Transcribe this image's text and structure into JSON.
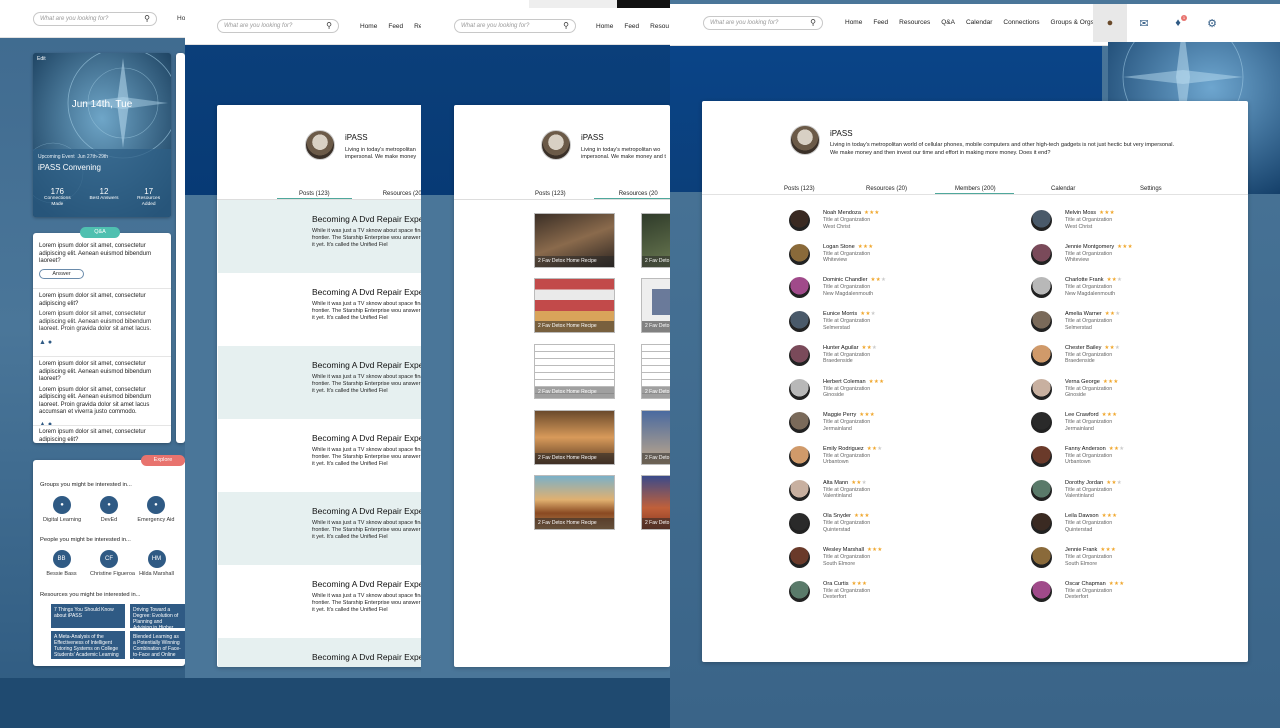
{
  "search_placeholder": "What are you looking for?",
  "nav": {
    "home": "Home",
    "feed": "Feed",
    "resources": "Resources",
    "qa": "Q&A",
    "calendar": "Calendar",
    "connections": "Connections",
    "groups": "Groups & Orgs",
    "home_short": "Ho",
    "resources_short": "Resou",
    "resources_short2": "Re"
  },
  "notification_badge": "1",
  "sidebar": {
    "edit": "Edit",
    "date": "Jun 14th, Tue",
    "upcoming_label": "Upcoming Event",
    "upcoming_date": "Jun 27th-29th",
    "event_name": "iPASS Convening",
    "stats": [
      {
        "value": "176",
        "label": "Connections Made"
      },
      {
        "value": "12",
        "label": "Best Answers"
      },
      {
        "value": "17",
        "label": "Resources Added"
      }
    ],
    "qa_pill": "Q&A",
    "qa_items": [
      {
        "q": "Lorem ipsum dolor sit amet, consectetur adipiscing elit. Aenean euismod bibendum laoreet?",
        "answer_btn": "Answer"
      },
      {
        "q": "Lorem ipsum dolor sit amet, consectetur adipiscing elit?",
        "a": "Lorem ipsum dolor sit amet, consectetur adipiscing elit. Aenean euismod bibendum laoreet. Proin gravida dolor sit amet lacus."
      },
      {
        "q": "Lorem ipsum dolor sit amet, consectetur adipiscing elit. Aenean euismod bibendum laoreet?",
        "a": "Lorem ipsum dolor sit amet, consectetur adipiscing elit. Aenean euismod bibendum laoreet. Proin gravida dolor sit amet lacus accumsan et viverra justo commodo."
      },
      {
        "q": "Lorem ipsum dolor sit amet, consectetur adipiscing elit?"
      }
    ],
    "explore_pill": "Explore",
    "groups_heading": "Groups you might be interested in...",
    "groups": [
      "Digital Learning",
      "DevEd",
      "Emergency Aid"
    ],
    "people_heading": "People you might be interested in...",
    "people": [
      {
        "initials": "BB",
        "name": "Bessie Bass"
      },
      {
        "initials": "CF",
        "name": "Christine Figueroa"
      },
      {
        "initials": "HM",
        "name": "Hilda Marshall"
      }
    ],
    "resources_heading": "Resources you might be interested in...",
    "resources": [
      "7 Things You Should Know about iPASS",
      "Driving Toward a Degree: Evolution of Planning and Advising in Higher Edu...",
      "A Meta-Analysis of the Effectiveness of Intelligent Tutoring Systems on College Students' Academic Learning",
      "Blended Learning as a Potentially Winning Combination of Face-to-Face and Online Learn..."
    ]
  },
  "org": {
    "name": "iPASS",
    "description": "Living in today's metropolitan world of cellular phones, mobile computers and other high-tech gadgets is not just hectic but very impersonal. We make money and then invest our time and effort in making more money. Does it end?",
    "desc_short_1": "Living in today's metropolitan",
    "desc_short_2": "impersonal. We make money",
    "desc_short_3": "Living in today's metropolitan wo",
    "desc_short_4": "impersonal. We make money and t"
  },
  "tabs": {
    "posts": "Posts (123)",
    "resources": "Resources (20)",
    "resources_short": "Resources (20",
    "members": "Members (200)",
    "calendar": "Calendar",
    "settings": "Settings"
  },
  "posts": [
    {
      "title": "Becoming A Dvd Repair Expe",
      "body": "While it was just a TV sknow about space final frontier. The Starship Enterprise wou answer to it yet. It's called the Unified Fiel"
    },
    {
      "title": "Becoming A Dvd Repair Expe",
      "body": "While it was just a TV sknow about space final frontier. The Starship Enterprise wou answer to it yet. It's called the Unified Fiel"
    },
    {
      "title": "Becoming A Dvd Repair Expe",
      "body": "While it was just a TV sknow about space final frontier. The Starship Enterprise wou answer to it yet. It's called the Unified Fiel"
    },
    {
      "title": "Becoming A Dvd Repair Expe",
      "body": "While it was just a TV sknow about space final frontier. The Starship Enterprise wou answer to it yet. It's called the Unified Fiel"
    },
    {
      "title": "Becoming A Dvd Repair Expe",
      "body": "While it was just a TV sknow about space final frontier. The Starship Enterprise wou answer to it yet. It's called the Unified Fiel"
    },
    {
      "title": "Becoming A Dvd Repair Expe",
      "body": "While it was just a TV sknow about space final frontier. The Starship Enterprise wou answer to it yet. It's called the Unified Fiel"
    },
    {
      "title": "Becoming A Dvd Repair Expe",
      "body": ""
    }
  ],
  "resources_grid": {
    "caption": "2 Fav Detox Home Recipe",
    "caption_short": "2 Fav Deto"
  },
  "members_left": [
    {
      "name": "Noah Mendoza",
      "title": "Title at Organization",
      "location": "West Christ",
      "stars": 3
    },
    {
      "name": "Logan Stone",
      "title": "Title at Organization",
      "location": "Whiteview",
      "stars": 3
    },
    {
      "name": "Dominic Chandler",
      "title": "Title at Organization",
      "location": "New Magdalenmouth",
      "stars": 2
    },
    {
      "name": "Eunice Morris",
      "title": "Title at Organization",
      "location": "Selmerstad",
      "stars": 2
    },
    {
      "name": "Hunter Aguilar",
      "title": "Title at Organization",
      "location": "Braedenside",
      "stars": 2
    },
    {
      "name": "Herbert Coleman",
      "title": "Title at Organization",
      "location": "Ginoside",
      "stars": 3
    },
    {
      "name": "Maggie Perry",
      "title": "Title at Organization",
      "location": "Jermainland",
      "stars": 3
    },
    {
      "name": "Emily Rodriguez",
      "title": "Title at Organization",
      "location": "Urbantown",
      "stars": 2
    },
    {
      "name": "Alta Mann",
      "title": "Title at Organization",
      "location": "Valentinland",
      "stars": 2
    },
    {
      "name": "Ola Snyder",
      "title": "Title at Organization",
      "location": "Quinterstad",
      "stars": 3
    },
    {
      "name": "Wesley Marshall",
      "title": "Title at Organization",
      "location": "South Elmore",
      "stars": 3
    },
    {
      "name": "Ora Curtis",
      "title": "Title at Organization",
      "location": "Dexterfort",
      "stars": 3
    }
  ],
  "members_right": [
    {
      "name": "Melvin Moss",
      "title": "Title at Organization",
      "location": "West Christ",
      "stars": 3
    },
    {
      "name": "Jennie Montgomery",
      "title": "Title at Organization",
      "location": "Whiteview",
      "stars": 3
    },
    {
      "name": "Charlotte Frank",
      "title": "Title at Organization",
      "location": "New Magdalenmouth",
      "stars": 2
    },
    {
      "name": "Amelia Warner",
      "title": "Title at Organization",
      "location": "Selmerstad",
      "stars": 2
    },
    {
      "name": "Chester Bailey",
      "title": "Title at Organization",
      "location": "Braedenside",
      "stars": 2
    },
    {
      "name": "Verna George",
      "title": "Title at Organization",
      "location": "Ginoside",
      "stars": 3
    },
    {
      "name": "Lee Crawford",
      "title": "Title at Organization",
      "location": "Jermainland",
      "stars": 3
    },
    {
      "name": "Fanny Anderson",
      "title": "Title at Organization",
      "location": "Urbantown",
      "stars": 2
    },
    {
      "name": "Dorothy Jordan",
      "title": "Title at Organization",
      "location": "Valentinland",
      "stars": 2
    },
    {
      "name": "Leila Dawson",
      "title": "Title at Organization",
      "location": "Quinterstad",
      "stars": 3
    },
    {
      "name": "Jennie Frank",
      "title": "Title at Organization",
      "location": "South Elmore",
      "stars": 3
    },
    {
      "name": "Oscar Chapman",
      "title": "Title at Organization",
      "location": "Dexterfort",
      "stars": 3
    }
  ],
  "colors": {
    "accent_teal": "#4fc0b0",
    "explore_pink": "#e8736e",
    "navy": "#0b3f7a",
    "star": "#f0a830"
  },
  "icons": [
    "search-icon",
    "avatar-icon",
    "mail-icon",
    "bell-icon",
    "gear-icon",
    "like-icon",
    "comment-icon",
    "group-icon"
  ]
}
